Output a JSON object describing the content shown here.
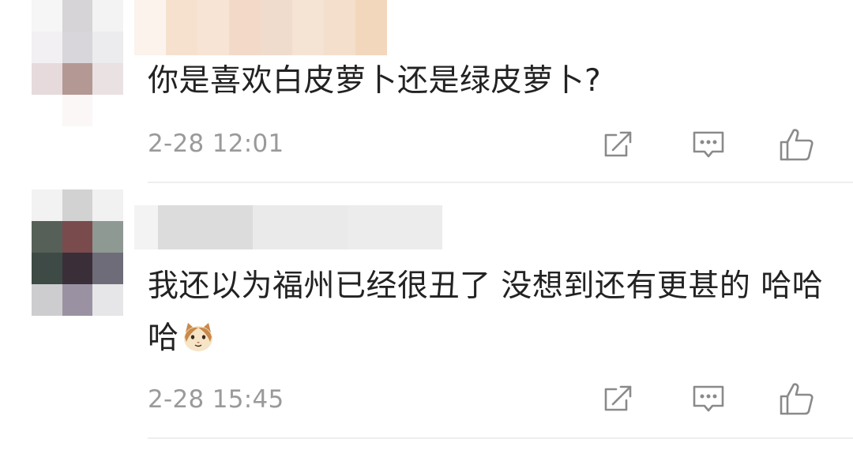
{
  "comments": [
    {
      "text": "你是喜欢白皮萝卜还是绿皮萝卜?",
      "timestamp": "2-28 12:01",
      "avatar_icon": "pixelated-avatar",
      "actions": [
        "share-icon",
        "reply-icon",
        "like-icon"
      ]
    },
    {
      "text": "我还以为福州已经很丑了 没想到还有更甚的 哈哈哈",
      "emoji": "cat-face-emoji",
      "timestamp": "2-28 15:45",
      "avatar_icon": "pixelated-avatar",
      "actions": [
        "share-icon",
        "reply-icon",
        "like-icon"
      ]
    }
  ],
  "colors": {
    "text": "#222222",
    "meta": "#9a9a9a",
    "icon": "#8a8a8a",
    "divider": "#eeeeee"
  }
}
